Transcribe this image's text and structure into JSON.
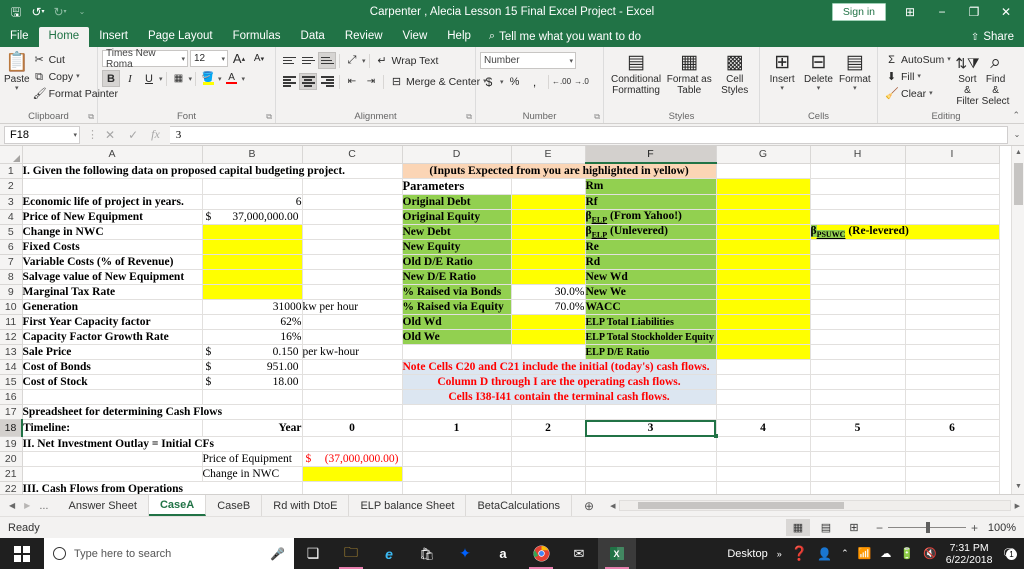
{
  "titlebar": {
    "title": "Carpenter , Alecia Lesson 15 Final Excel Project  -  Excel",
    "save_icon": "save-icon",
    "undo_icon": "undo-icon",
    "redo_icon": "redo-icon",
    "customize_icon": "customize-qat-icon",
    "signin_label": "Sign in",
    "ribbon_display_icon": "ribbon-display-options-icon",
    "minimize_icon": "minimize-icon",
    "restore_icon": "restore-icon",
    "close_icon": "close-icon"
  },
  "ribbon_tabs": {
    "tabs": [
      "File",
      "Home",
      "Insert",
      "Page Layout",
      "Formulas",
      "Data",
      "Review",
      "View",
      "Help"
    ],
    "active": "Home",
    "tellme": "Tell me what you want to do",
    "share": "Share"
  },
  "ribbon": {
    "clipboard": {
      "label": "Clipboard",
      "paste": "Paste",
      "cut": "Cut",
      "copy": "Copy",
      "format_painter": "Format Painter"
    },
    "font": {
      "label": "Font",
      "font_name": "Times New Roma",
      "font_size": "12",
      "grow": "A",
      "shrink": "A",
      "bold": "B",
      "italic": "I",
      "underline": "U",
      "highlight_color": "#ffff00",
      "font_color": "#ff0000"
    },
    "alignment": {
      "label": "Alignment",
      "wrap_text": "Wrap Text",
      "merge_center": "Merge & Center"
    },
    "number": {
      "label": "Number",
      "format": "Number",
      "currency": "$",
      "percent": "%",
      "comma": ","
    },
    "styles": {
      "label": "Styles",
      "conditional_formatting": "Conditional\nFormatting",
      "conditional_formatting_l1": "Conditional",
      "conditional_formatting_l2": "Formatting",
      "format_as_table_l1": "Format as",
      "format_as_table_l2": "Table",
      "cell_styles_l1": "Cell",
      "cell_styles_l2": "Styles"
    },
    "cells": {
      "label": "Cells",
      "insert": "Insert",
      "delete": "Delete",
      "format": "Format"
    },
    "editing": {
      "label": "Editing",
      "autosum": "AutoSum",
      "fill": "Fill",
      "clear": "Clear",
      "sort_filter_l1": "Sort &",
      "sort_filter_l2": "Filter",
      "find_select_l1": "Find &",
      "find_select_l2": "Select"
    }
  },
  "formula_bar": {
    "name_box": "F18",
    "cancel_icon": "cancel-icon",
    "enter_icon": "confirm-icon",
    "fx_icon": "insert-function-icon",
    "value": "3"
  },
  "grid": {
    "columns": [
      "A",
      "B",
      "C",
      "D",
      "E",
      "F",
      "G",
      "H",
      "I"
    ],
    "selected_column": "F",
    "selected_row": "18",
    "selected_cell": "F18",
    "rows": [
      "1",
      "2",
      "3",
      "4",
      "5",
      "6",
      "7",
      "8",
      "9",
      "10",
      "11",
      "12",
      "13",
      "14",
      "15",
      "16",
      "17",
      "18",
      "19",
      "20",
      "21",
      "22"
    ],
    "cells": {
      "A1": "I. Given the following data on proposed capital budgeting project.",
      "D1": "(Inputs Expected from you are highlighted in yellow)",
      "D2": "Parameters",
      "F2": "Rm",
      "A3": "Economic life of project in years.",
      "B3": "6",
      "D3": "Original Debt",
      "F3": "Rf",
      "A4": "Price of New Equipment",
      "B4_currency": "$",
      "B4": "37,000,000.00",
      "D4": "Original Equity",
      "F4_pre": "β",
      "F4_sub": "ELP",
      "F4_post": " (From Yahoo!)",
      "A5": "Change in NWC",
      "D5": "New Debt",
      "F5_pre": "β",
      "F5_sub": "ELP",
      "F5_post": " (Unlevered)",
      "H5_pre": "β",
      "H5_sub": "PSUWC",
      "H5_post": " (Re-levered)",
      "A6": "Fixed Costs",
      "D6": "New Equity",
      "F6": "Re",
      "A7": "Variable Costs (% of Revenue)",
      "D7": "Old D/E Ratio",
      "F7": "Rd",
      "A8": "Salvage value of New Equipment",
      "D8": "New D/E Ratio",
      "F8": "New Wd",
      "A9": "Marginal Tax Rate",
      "D9": "% Raised via Bonds",
      "E9": "30.0%",
      "F9": "New We",
      "A10": "Generation",
      "B10": "31000",
      "C10": "kw per hour",
      "D10": "% Raised via Equity",
      "E10": "70.0%",
      "F10": "WACC",
      "A11": "First Year Capacity factor",
      "B11": "62%",
      "D11": "Old Wd",
      "F11": "ELP Total Liabilities",
      "A12": "Capacity Factor Growth Rate",
      "B12": "16%",
      "D12": "Old We",
      "F12": "ELP Total Stockholder Equity",
      "A13": "Sale Price",
      "B13_currency": "$",
      "B13": "0.150",
      "C13": "per kw-hour",
      "F13": "ELP D/E Ratio",
      "A14": "Cost of Bonds",
      "B14_currency": "$",
      "B14": "951.00",
      "D14": "Note Cells C20 and C21 include the initial (today's) cash flows.",
      "A15": "Cost of Stock",
      "B15_currency": "$",
      "B15": "18.00",
      "D15": "Column D through I are the operating cash flows.",
      "D16": "Cells I38-I41 contain the terminal cash flows.",
      "A17": "Spreadsheet for determining Cash Flows",
      "A18": "Timeline:",
      "B18": "Year",
      "C18": "0",
      "D18": "1",
      "E18": "2",
      "F18": "3",
      "G18": "4",
      "H18": "5",
      "I18": "6",
      "A19": "II. Net Investment Outlay = Initial CFs",
      "B20": "Price of Equipment",
      "C20_currency": "$",
      "C20": "(37,000,000.00)",
      "B21": "Change in NWC",
      "A22": "III. Cash Flows from Operations"
    }
  },
  "sheet_tabs": {
    "first_icon": "first-sheet-icon",
    "prev_icon": "previous-sheet-icon",
    "ellipsis": "...",
    "tabs": [
      "Answer Sheet",
      "CaseA",
      "CaseB",
      "Rd with DtoE",
      "ELP balance Sheet",
      "BetaCalculations"
    ],
    "active": "CaseA",
    "add_label": "+"
  },
  "status_bar": {
    "status": "Ready",
    "normal_view_icon": "normal-view-icon",
    "page_layout_icon": "page-layout-view-icon",
    "page_break_icon": "page-break-preview-icon",
    "zoom_out": "−",
    "zoom_in": "+",
    "zoom_level": "100%"
  },
  "taskbar": {
    "start_icon": "windows-start-icon",
    "search_placeholder": "Type here to search",
    "mic_icon": "microphone-icon",
    "task_view_icon": "task-view-icon",
    "apps": [
      {
        "name": "file-explorer-icon",
        "glyph": "🗂"
      },
      {
        "name": "edge-icon",
        "glyph": "e"
      },
      {
        "name": "microsoft-store-icon",
        "glyph": "🛍"
      },
      {
        "name": "dropbox-icon",
        "glyph": "✤"
      },
      {
        "name": "amazon-icon",
        "glyph": "a"
      },
      {
        "name": "chrome-icon",
        "glyph": "◉"
      },
      {
        "name": "mail-icon",
        "glyph": "✉"
      },
      {
        "name": "excel-icon",
        "glyph": "X"
      }
    ],
    "show_desktop": "Desktop",
    "overflow": "»",
    "help_icon": "help-icon",
    "people_icon": "people-icon",
    "chevron_icon": "show-hidden-icons-icon",
    "wifi_icon": "wifi-icon",
    "onedrive_icon": "onedrive-icon",
    "battery_icon": "battery-icon",
    "volume_icon": "volume-muted-icon",
    "time": "7:31 PM",
    "date": "6/22/2018",
    "notification_icon": "notifications-icon",
    "notification_count": "1"
  }
}
